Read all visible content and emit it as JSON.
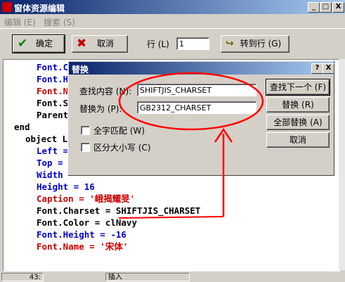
{
  "window": {
    "title": "窗体资源编辑",
    "minimize_label": "_",
    "maximize_label": "□",
    "close_label": "X"
  },
  "menu": {
    "edit": "编辑 (E)",
    "search": "搜索 (S)"
  },
  "toolbar": {
    "ok": "确定",
    "cancel": "取消",
    "line_label": "行 (L)",
    "line_value": "1",
    "goto": "转到行 (G)"
  },
  "code_lines": [
    "Font.C",
    "Font.H",
    "Font.N",
    "Font.S",
    "Parent",
    "end",
    "object L",
    "Left =",
    "Top =",
    "Width",
    "Height = 16",
    "Caption = '峨揭耀旻'",
    "Font.Charset = SHIFTJIS_CHARSET",
    "Font.Color = clNavy",
    "Font.Height = -16",
    "Font.Name = '宋体'"
  ],
  "dialog": {
    "title": "替换",
    "help_label": "?",
    "close_label": "X",
    "find_label": "查找内容 (N):",
    "find_value": "SHIFTJIS_CHARSET",
    "replace_label": "替换为 (P):",
    "replace_value": "GB2312_CHARSET",
    "whole_word": "全字匹配 (W)",
    "match_case": "区分大小写 (C)",
    "find_next": "查找下一个 (F)",
    "replace": "替换 (R)",
    "replace_all": "全部替换 (A)",
    "cancel": "取消"
  },
  "status": {
    "position": "43:",
    "mode": "插入"
  },
  "colors": {
    "keyword_blue": "#0000cc",
    "property_red": "#cc0000",
    "annotation_red": "#ff0000"
  }
}
